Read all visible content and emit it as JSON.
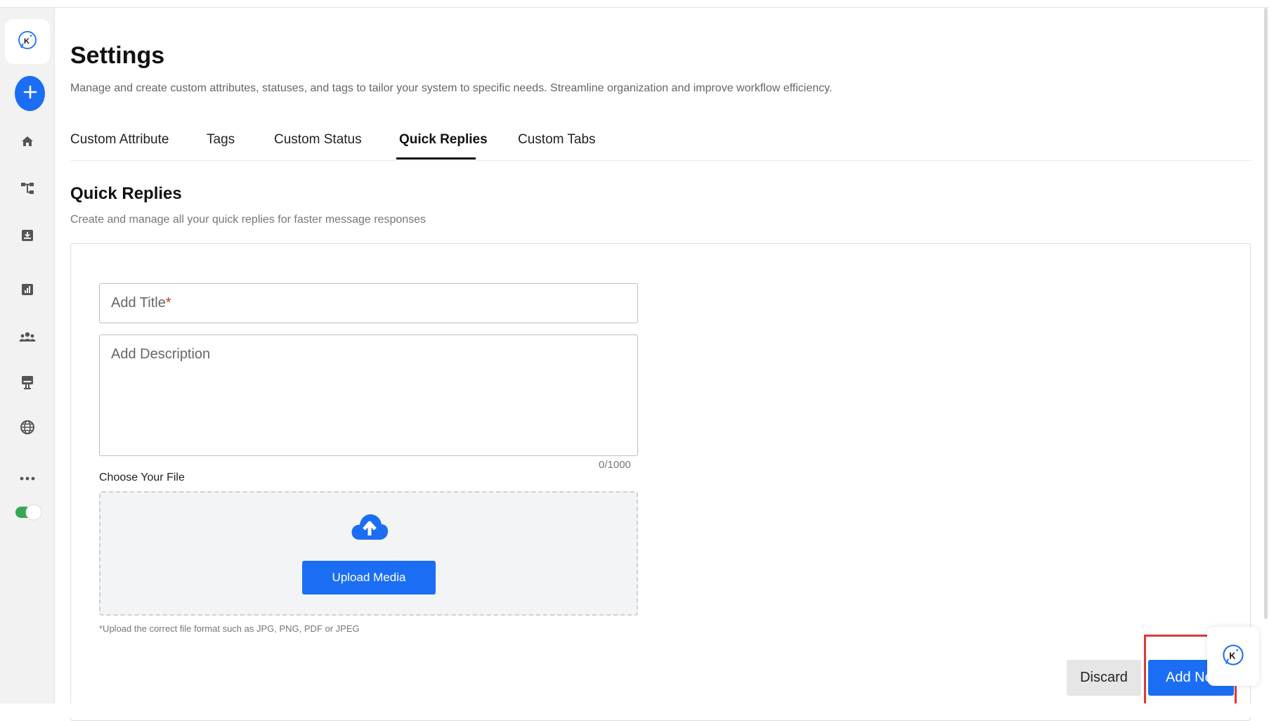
{
  "brand": {
    "accent": "#1b6ef3",
    "danger": "#d93a3a",
    "toggle_on": "#34a853"
  },
  "sidebar": {
    "logo_icon": "chat-bubble-k-icon",
    "add_icon": "plus-icon",
    "items": [
      {
        "name": "home",
        "icon": "home-icon"
      },
      {
        "name": "workflow",
        "icon": "flow-icon"
      },
      {
        "name": "inbox",
        "icon": "download-tray-icon"
      },
      {
        "name": "reports",
        "icon": "bar-chart-icon"
      },
      {
        "name": "team",
        "icon": "team-icon"
      },
      {
        "name": "kiosk",
        "icon": "monitor-icon"
      },
      {
        "name": "globe",
        "icon": "globe-icon"
      },
      {
        "name": "more",
        "icon": "more-horizontal-icon"
      }
    ],
    "status_toggle": "on"
  },
  "header": {
    "title": "Settings",
    "subtitle": "Manage and create custom attributes, statuses, and tags to tailor your system to specific needs. Streamline organization and improve workflow efficiency."
  },
  "tabs": [
    {
      "label": "Custom Attribute",
      "active": false
    },
    {
      "label": "Tags",
      "active": false
    },
    {
      "label": "Custom Status",
      "active": false
    },
    {
      "label": "Quick Replies",
      "active": true
    },
    {
      "label": "Custom Tabs",
      "active": false
    }
  ],
  "section": {
    "title": "Quick Replies",
    "subtitle": "Create and manage all your quick replies for faster message responses"
  },
  "form": {
    "title_placeholder": "Add Title",
    "required_mark": "*",
    "description_placeholder": "Add Description",
    "char_counter": "0/1000",
    "file_label": "Choose Your File",
    "upload_button": "Upload Media",
    "upload_icon": "cloud-upload-icon",
    "file_hint": "*Upload the correct file format such as JPG, PNG, PDF or JPEG"
  },
  "actions": {
    "discard": "Discard",
    "add_new": "Add Ne"
  },
  "chat_widget": {
    "icon": "chat-bubble-k-icon"
  }
}
